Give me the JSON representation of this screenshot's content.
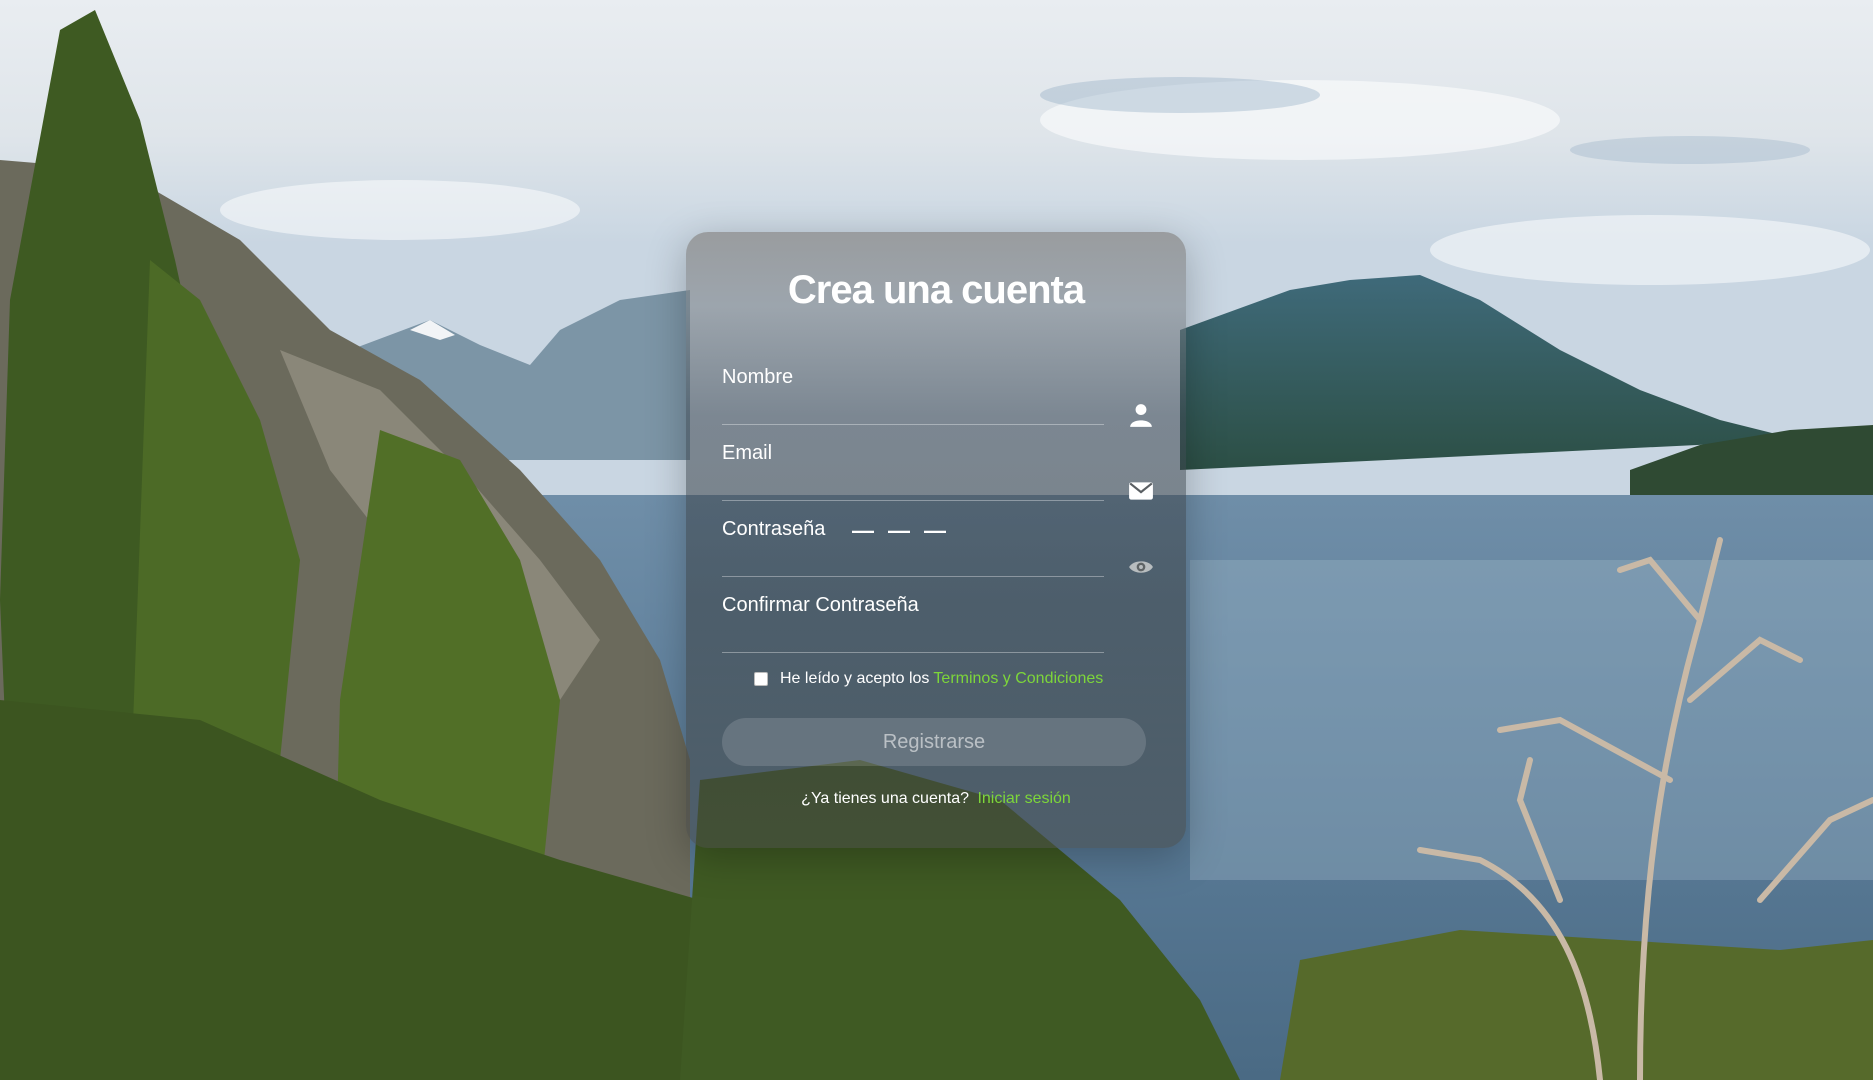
{
  "form": {
    "title": "Crea una cuenta",
    "name_label": "Nombre",
    "email_label": "Email",
    "password_label": "Contraseña",
    "password_value": "———",
    "confirm_label": "Confirmar Contraseña",
    "terms_text": "He leído y acepto los",
    "terms_link": "Terminos y Condiciones",
    "register_button": "Registrarse",
    "login_prompt": "¿Ya tienes una cuenta?",
    "login_link": "Iniciar sesión"
  },
  "icons": {
    "name": "user-icon",
    "email": "envelope-icon",
    "password": "eye-icon"
  },
  "colors": {
    "accent": "#7dd63a",
    "text": "#ffffff"
  }
}
